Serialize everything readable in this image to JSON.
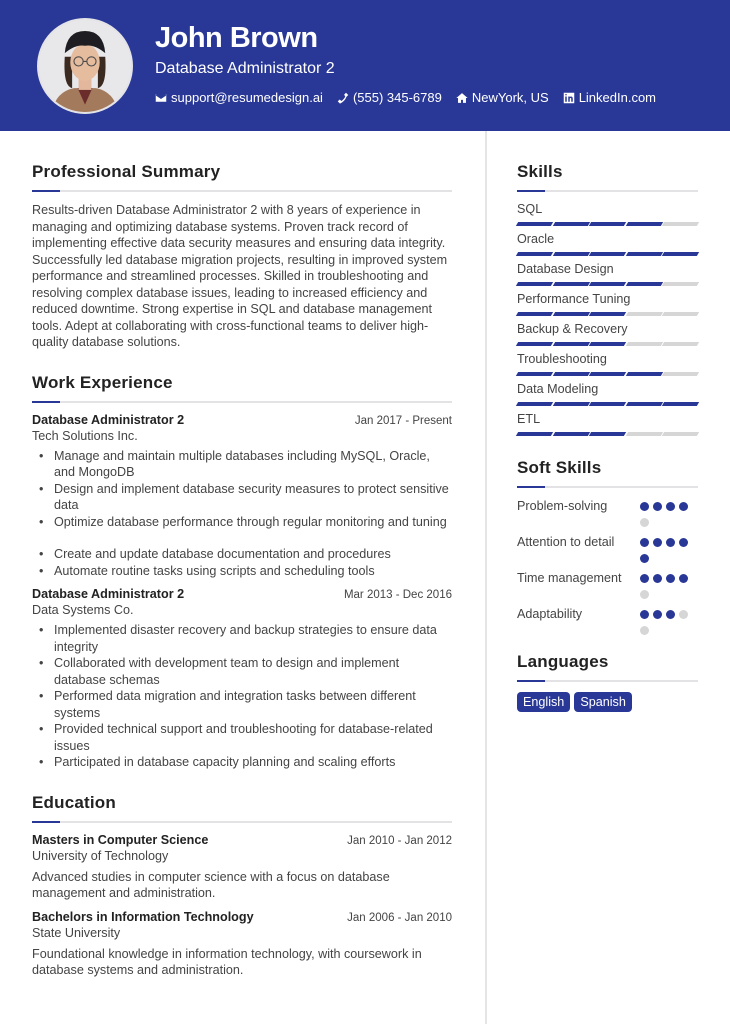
{
  "header": {
    "name": "John Brown",
    "title": "Database Administrator 2",
    "contacts": [
      {
        "icon": "envelope-icon",
        "text": "support@resumedesign.ai"
      },
      {
        "icon": "phone-icon",
        "text": "(555) 345-6789"
      },
      {
        "icon": "home-icon",
        "text": "NewYork, US"
      },
      {
        "icon": "linkedin-icon",
        "text": "LinkedIn.com"
      }
    ]
  },
  "colors": {
    "accent": "#293896",
    "inactive": "#d6d6d6",
    "text": "#444444"
  },
  "summary": {
    "title": "Professional Summary",
    "text": "Results-driven Database Administrator 2 with 8 years of experience in managing and optimizing database systems. Proven track record of implementing effective data security measures and ensuring data integrity. Successfully led database migration projects, resulting in improved system performance and streamlined processes. Skilled in troubleshooting and resolving complex database issues, leading to increased efficiency and reduced downtime. Strong expertise in SQL and database management tools. Adept at collaborating with cross-functional teams to deliver high-quality database solutions."
  },
  "experience": {
    "title": "Work Experience",
    "jobs": [
      {
        "role": "Database Administrator 2",
        "dates": "Jan 2017 - Present",
        "company": "Tech Solutions Inc.",
        "bullets": [
          "Manage and maintain multiple databases including MySQL, Oracle, and MongoDB",
          "Design and implement database security measures to protect sensitive data",
          "Optimize database performance through regular monitoring and tuning",
          "Create and update database documentation and procedures",
          "Automate routine tasks using scripts and scheduling tools"
        ]
      },
      {
        "role": "Database Administrator 2",
        "dates": "Mar 2013 - Dec 2016",
        "company": "Data Systems Co.",
        "bullets": [
          "Implemented disaster recovery and backup strategies to ensure data integrity",
          "Collaborated with development team to design and implement database schemas",
          "Performed data migration and integration tasks between different systems",
          "Provided technical support and troubleshooting for database-related issues",
          "Participated in database capacity planning and scaling efforts"
        ]
      }
    ]
  },
  "education": {
    "title": "Education",
    "items": [
      {
        "degree": "Masters in Computer Science",
        "dates": "Jan 2010 - Jan 2012",
        "school": "University of Technology",
        "description": "Advanced studies in computer science with a focus on database management and administration."
      },
      {
        "degree": "Bachelors in Information Technology",
        "dates": "Jan 2006 - Jan 2010",
        "school": "State University",
        "description": "Foundational knowledge in information technology, with coursework in database systems and administration."
      }
    ]
  },
  "skills": {
    "title": "Skills",
    "max": 5,
    "items": [
      {
        "name": "SQL",
        "level": 4
      },
      {
        "name": "Oracle",
        "level": 5
      },
      {
        "name": "Database Design",
        "level": 4
      },
      {
        "name": "Performance Tuning",
        "level": 3
      },
      {
        "name": "Backup & Recovery",
        "level": 3
      },
      {
        "name": "Troubleshooting",
        "level": 4
      },
      {
        "name": "Data Modeling",
        "level": 5
      },
      {
        "name": "ETL",
        "level": 3
      }
    ]
  },
  "soft_skills": {
    "title": "Soft Skills",
    "max": 5,
    "items": [
      {
        "name": "Problem-solving",
        "level": 4
      },
      {
        "name": "Attention to detail",
        "level": 5
      },
      {
        "name": "Time management",
        "level": 4
      },
      {
        "name": "Adaptability",
        "level": 3
      }
    ]
  },
  "languages": {
    "title": "Languages",
    "items": [
      "English",
      "Spanish"
    ]
  }
}
